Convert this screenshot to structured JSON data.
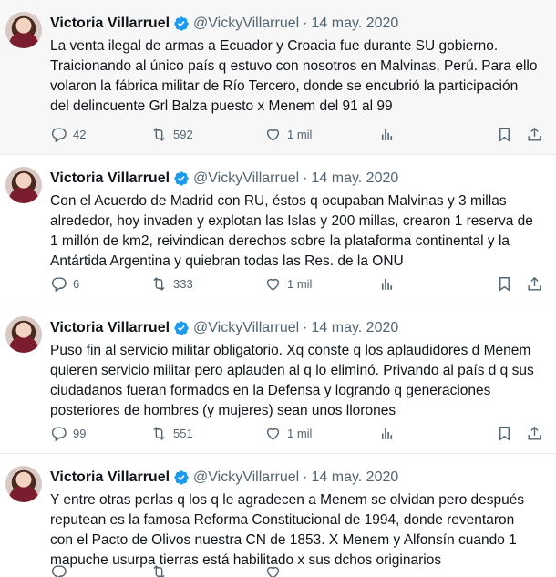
{
  "tweets": [
    {
      "name": "Victoria Villarruel",
      "handle": "@VickyVillarruel",
      "date": "14 may. 2020",
      "text": "La venta ilegal de armas a Ecuador y Croacia fue durante SU gobierno. Traicionando al único país q estuvo con nosotros en Malvinas, Perú. Para ello volaron la fábrica militar de Río Tercero, donde se encubrió la participación del delincuente Grl Balza puesto x Menem del 91 al 99",
      "replies": "42",
      "retweets": "592",
      "likes": "1 mil"
    },
    {
      "name": "Victoria Villarruel",
      "handle": "@VickyVillarruel",
      "date": "14 may. 2020",
      "text": "Con el Acuerdo de Madrid con RU, éstos q ocupaban Malvinas y 3 millas alrededor, hoy invaden y explotan las Islas y 200 millas, crearon 1 reserva de 1 millón de km2, reivindican derechos sobre la plataforma continental y la Antártida Argentina y quiebran todas las Res. de la ONU",
      "replies": "6",
      "retweets": "333",
      "likes": "1 mil"
    },
    {
      "name": "Victoria Villarruel",
      "handle": "@VickyVillarruel",
      "date": "14 may. 2020",
      "text": "Puso fin al servicio militar obligatorio. Xq conste q los aplaudidores d Menem quieren servicio militar pero aplauden al q lo eliminó. Privando al país d q sus ciudadanos fueran formados en la Defensa y logrando q generaciones posteriores de hombres (y mujeres) sean unos llorones",
      "replies": "99",
      "retweets": "551",
      "likes": "1 mil"
    },
    {
      "name": "Victoria Villarruel",
      "handle": "@VickyVillarruel",
      "date": "14 may. 2020",
      "text": "Y entre otras perlas q los q le agradecen a Menem se olvidan pero después reputean es la famosa Reforma Constitucional de 1994, donde reventaron con el Pacto de Olivos nuestra CN de 1853. X Menem y Alfonsín cuando 1 mapuche usurpa tierras está habilitado x sus dchos originarios",
      "replies": "",
      "retweets": "",
      "likes": ""
    }
  ],
  "separator": "·",
  "colors": {
    "verified": "#1d9bf0",
    "muted": "#536471",
    "text": "#0f1419"
  },
  "icons": [
    "verified-badge-icon",
    "reply-icon",
    "retweet-icon",
    "like-icon",
    "views-icon",
    "bookmark-icon",
    "share-icon"
  ]
}
